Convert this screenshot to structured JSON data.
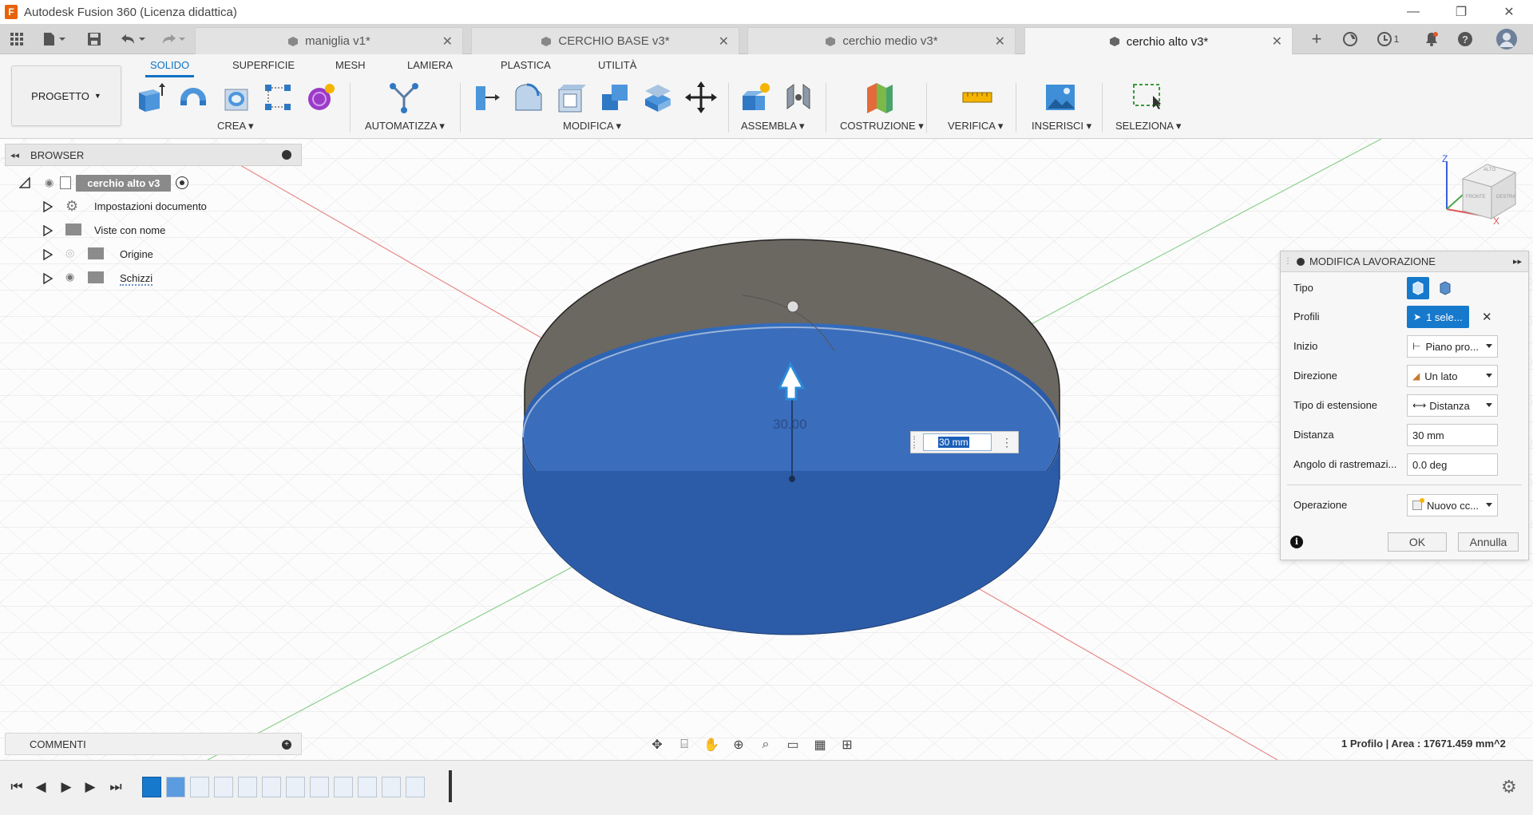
{
  "window": {
    "title": "Autodesk Fusion 360 (Licenza didattica)",
    "app_icon": "F",
    "minimize": "—",
    "maximize": "❐",
    "close": "✕"
  },
  "tabs": [
    {
      "label": "maniglia v1*"
    },
    {
      "label": "CERCHIO BASE v3*"
    },
    {
      "label": "cerchio medio v3*"
    },
    {
      "label": "cerchio alto v3*",
      "active": true
    }
  ],
  "tabbar_right": {
    "notifications_count": "1"
  },
  "ribbon": {
    "project_button": "PROGETTO",
    "tabs": [
      "SOLIDO",
      "SUPERFICIE",
      "MESH",
      "LAMIERA",
      "PLASTICA",
      "UTILITÀ"
    ],
    "active_tab": "SOLIDO",
    "groups": [
      "CREA",
      "AUTOMATIZZA",
      "MODIFICA",
      "ASSEMBLA",
      "COSTRUZIONE",
      "VERIFICA",
      "INSERISCI",
      "SELEZIONA"
    ]
  },
  "browser": {
    "title": "BROWSER",
    "root": "cerchio alto v3",
    "items": [
      {
        "label": "Impostazioni documento"
      },
      {
        "label": "Viste con nome"
      },
      {
        "label": "Origine"
      },
      {
        "label": "Schizzi"
      }
    ]
  },
  "viewport": {
    "dimension_label": "30.00",
    "distance_input": "30 mm",
    "status": "1 Profilo | Area : 17671.459 mm^2",
    "viewcube": {
      "axis_z": "Z",
      "axis_x": "X",
      "top": "ALTO",
      "front": "FRONTE",
      "right": "DESTRA"
    }
  },
  "dialog": {
    "title": "MODIFICA LAVORAZIONE",
    "rows": [
      {
        "label": "Tipo"
      },
      {
        "label": "Profili",
        "value": "1 sele..."
      },
      {
        "label": "Inizio",
        "value": "Piano pro..."
      },
      {
        "label": "Direzione",
        "value": "Un lato"
      },
      {
        "label": "Tipo di estensione",
        "value": "Distanza"
      },
      {
        "label": "Distanza",
        "value": "30 mm"
      },
      {
        "label": "Angolo di rastremazi...",
        "value": "0.0 deg"
      },
      {
        "label": "Operazione",
        "value": "Nuovo cc..."
      }
    ],
    "ok": "OK",
    "cancel": "Annulla"
  },
  "comments": {
    "title": "COMMENTI"
  },
  "colors": {
    "accent": "#0f72c5",
    "body_blue": "#2f63b4",
    "body_dark": "#6b6761",
    "selected_button": "#1679cc"
  }
}
